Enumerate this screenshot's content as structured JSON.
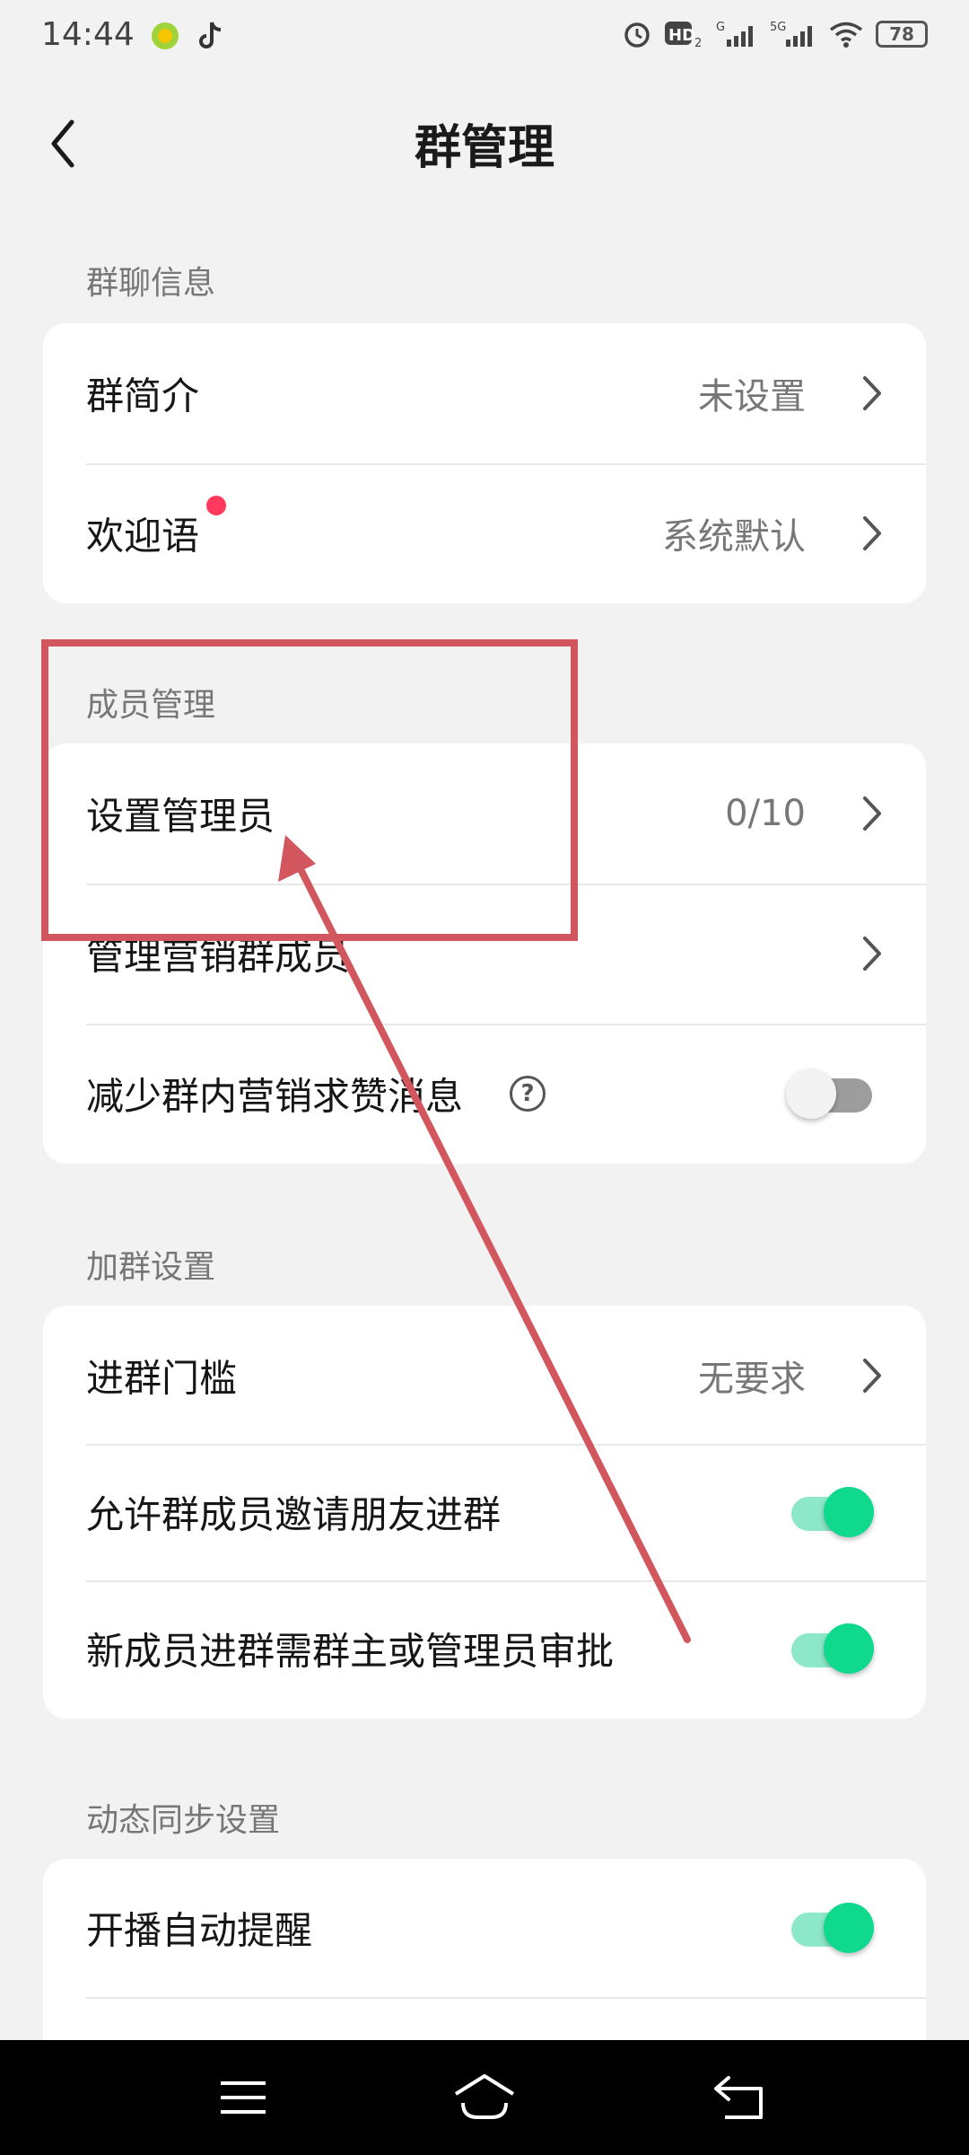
{
  "status_bar": {
    "time": "14:44",
    "battery": "78",
    "icons": [
      "app-notification-icon",
      "tiktok-icon",
      "alarm-icon",
      "hd-icon",
      "g-signal-icon",
      "5g-signal-icon",
      "wifi-icon",
      "battery-icon"
    ]
  },
  "header": {
    "title": "群管理",
    "back_icon": "back-arrow-icon"
  },
  "sections": [
    {
      "label": "群聊信息",
      "rows": [
        {
          "label": "群简介",
          "value": "未设置",
          "type": "link"
        },
        {
          "label": "欢迎语",
          "value": "系统默认",
          "type": "link",
          "badge": "red-dot"
        }
      ]
    },
    {
      "label": "成员管理",
      "rows": [
        {
          "label": "设置管理员",
          "value": "0/10",
          "type": "link"
        },
        {
          "label": "管理营销群成员",
          "value": "",
          "type": "link"
        },
        {
          "label": "减少群内营销求赞消息",
          "type": "toggle",
          "on": false,
          "help": "?"
        }
      ]
    },
    {
      "label": "加群设置",
      "rows": [
        {
          "label": "进群门槛",
          "value": "无要求",
          "type": "link"
        },
        {
          "label": "允许群成员邀请朋友进群",
          "type": "toggle",
          "on": true
        },
        {
          "label": "新成员进群需群主或管理员审批",
          "type": "toggle",
          "on": true
        }
      ]
    },
    {
      "label": "动态同步设置",
      "rows": [
        {
          "label": "开播自动提醒",
          "type": "toggle",
          "on": true
        }
      ]
    }
  ],
  "nav_bar": {
    "icons": [
      "menu-icon",
      "home-icon",
      "back-icon"
    ]
  },
  "colors": {
    "accent_green": "#0fd98c",
    "badge_red": "#ff3a5c",
    "annotation_red": "#d1565e"
  }
}
